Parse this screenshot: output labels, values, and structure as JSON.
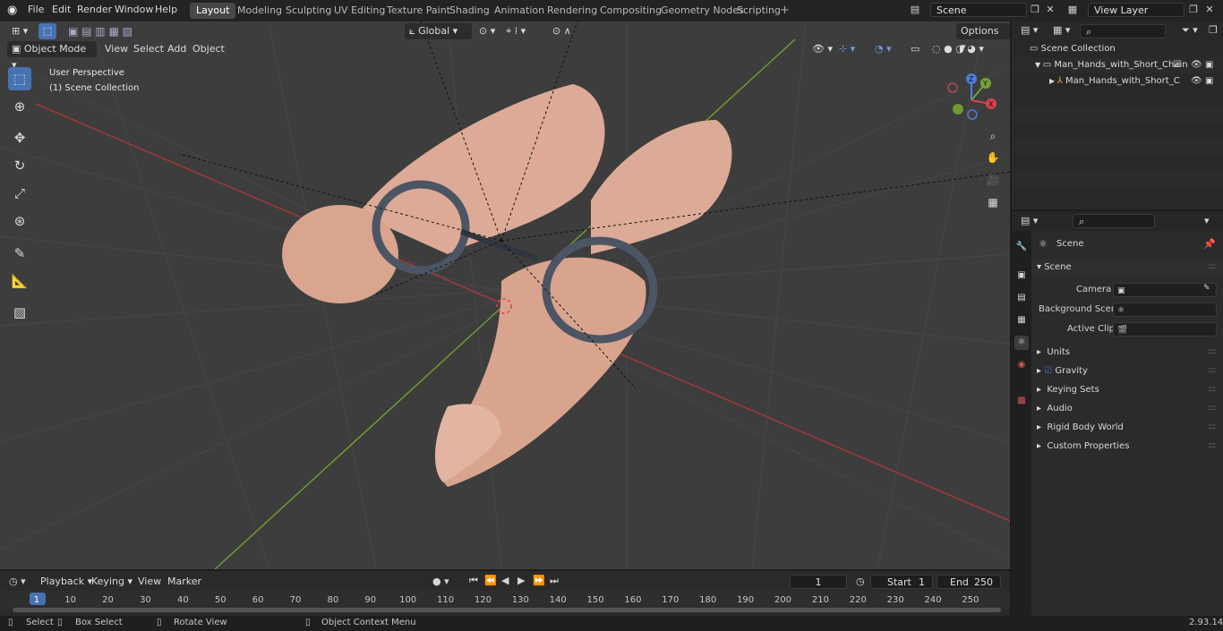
{
  "menu": [
    "File",
    "Edit",
    "Render",
    "Window",
    "Help"
  ],
  "workspaces": [
    "Layout",
    "Modeling",
    "Sculpting",
    "UV Editing",
    "Texture Paint",
    "Shading",
    "Animation",
    "Rendering",
    "Compositing",
    "Geometry Nodes",
    "Scripting"
  ],
  "active_workspace": "Layout",
  "scene_field": "Scene",
  "view_layer_field": "View Layer",
  "viewport": {
    "mode": "Object Mode",
    "menus": [
      "View",
      "Select",
      "Add",
      "Object"
    ],
    "transform_orientation": "Global",
    "options_label": "Options",
    "overlay_line1": "User Perspective",
    "overlay_line2": "(1) Scene Collection",
    "gizmo_axes": [
      "Z",
      "Y",
      "X"
    ]
  },
  "outliner": {
    "root": "Scene Collection",
    "collection": "Man_Hands_with_Short_Chain",
    "object": "Man_Hands_with_Short_C"
  },
  "properties": {
    "breadcrumb": "Scene",
    "section": "Scene",
    "camera_label": "Camera",
    "background_scene_label": "Background Scene",
    "active_clip_label": "Active Clip",
    "panels": [
      "Units",
      "Gravity",
      "Keying Sets",
      "Audio",
      "Rigid Body World",
      "Custom Properties"
    ]
  },
  "timeline": {
    "menus": [
      "Playback",
      "Keying",
      "View",
      "Marker"
    ],
    "current_frame": "1",
    "start_label": "Start",
    "start_value": "1",
    "end_label": "End",
    "end_value": "250",
    "ruler": [
      "1",
      "10",
      "20",
      "30",
      "40",
      "50",
      "60",
      "70",
      "80",
      "90",
      "100",
      "110",
      "120",
      "130",
      "140",
      "150",
      "160",
      "170",
      "180",
      "190",
      "200",
      "210",
      "220",
      "230",
      "240",
      "250"
    ]
  },
  "statusbar": {
    "select": "Select",
    "box_select": "Box Select",
    "rotate_view": "Rotate View",
    "context_menu": "Object Context Menu",
    "version": "2.93.14"
  },
  "colors": {
    "accent": "#4772b3",
    "x_axis": "#c0393d",
    "y_axis": "#6d9a34",
    "skin": "#e0ad97"
  }
}
